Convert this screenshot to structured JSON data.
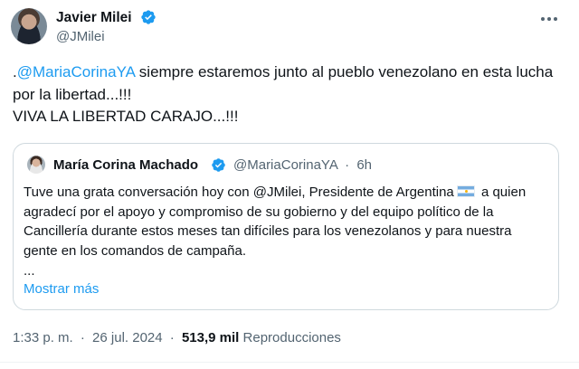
{
  "author": {
    "name": "Javier Milei",
    "handle": "@JMilei",
    "verified": true
  },
  "tweet": {
    "prefix": ".",
    "mention": "@MariaCorinaYA",
    "text_rest": " siempre estaremos junto al pueblo venezolano en esta lucha por la libertad...!!!",
    "line2": "VIVA LA LIBERTAD CARAJO...!!!"
  },
  "quoted": {
    "name": "María Corina Machado",
    "handle": "@MariaCorinaYA",
    "dot": "·",
    "time": "6h",
    "text_before_flag": "Tuve una grata conversación hoy con @JMilei, Presidente de Argentina",
    "text_after_flag": " a quien agradecí por el apoyo y compromiso de su gobierno y del equipo político de la Cancillería durante estos meses tan difíciles para los venezolanos y para nuestra gente en los comandos de campaña.",
    "ellipsis": "...",
    "show_more": "Mostrar más"
  },
  "footer": {
    "time": "1:33 p. m.",
    "dot1": "·",
    "date": "26 jul. 2024",
    "dot2": "·",
    "views_count": "513,9 mil",
    "views_label": "Reproducciones"
  },
  "colors": {
    "link": "#1d9bf0",
    "secondary_text": "#536471",
    "border": "#cfd9de",
    "verified_badge": "#1d9bf0"
  },
  "icons": {
    "verified": "verified-badge-icon",
    "more": "more-options-icon",
    "flag": "argentina-flag-icon"
  }
}
